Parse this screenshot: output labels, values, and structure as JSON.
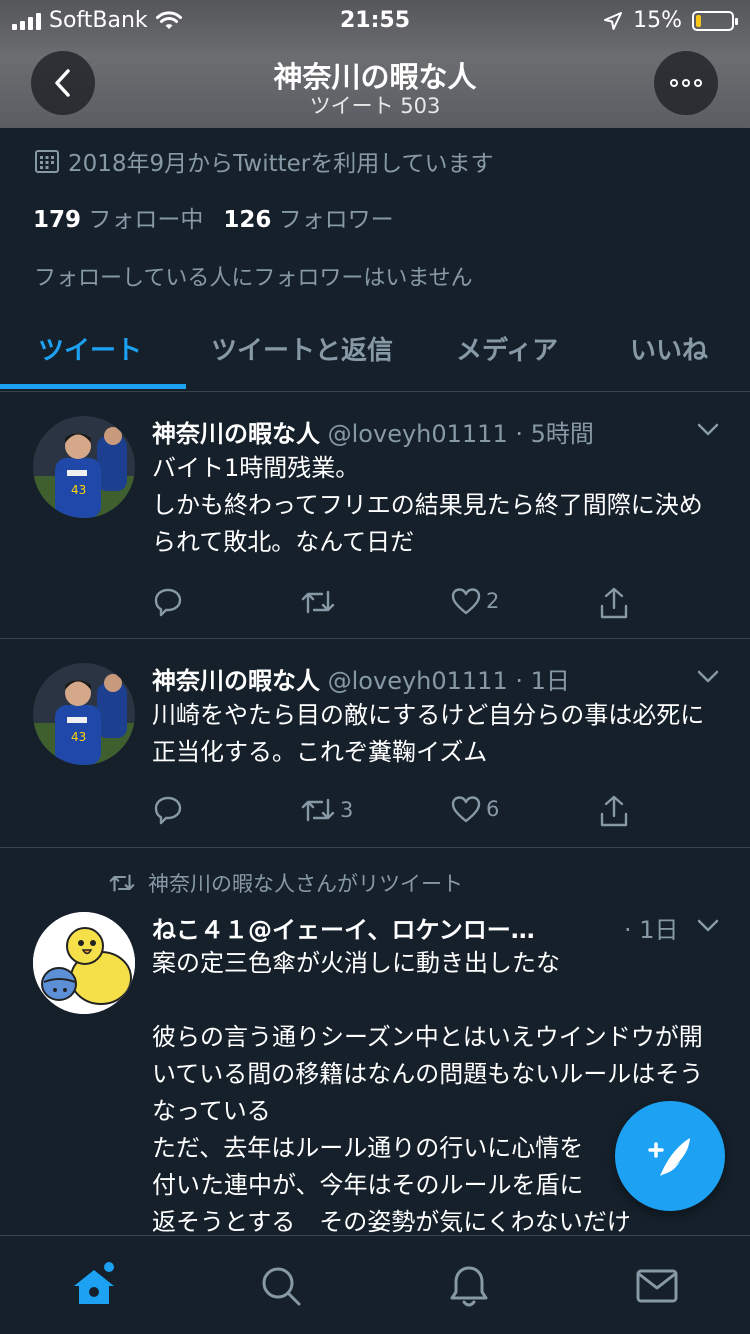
{
  "status_bar": {
    "carrier": "SoftBank",
    "time": "21:55",
    "battery_text": "15%",
    "battery_level": 0.15,
    "icons": [
      "signal-icon",
      "wifi-icon",
      "location-arrow-icon",
      "battery-icon"
    ]
  },
  "header": {
    "title": "神奈川の暇な人",
    "subtitle": "ツイート 503",
    "back_icon": "chevron-left-icon",
    "more_icon": "more-dots-icon"
  },
  "profile": {
    "joined": "2018年9月からTwitterを利用しています",
    "following_count": "179",
    "following_label": "フォロー中",
    "followers_count": "126",
    "followers_label": "フォロワー",
    "no_followers_you_know": "フォローしている人にフォロワーはいません"
  },
  "tabs": [
    {
      "label": "ツイート",
      "active": true
    },
    {
      "label": "ツイートと返信",
      "active": false
    },
    {
      "label": "メディア",
      "active": false
    },
    {
      "label": "いいね",
      "active": false
    }
  ],
  "tweets": [
    {
      "name": "神奈川の暇な人",
      "meta": "@loveyh01111 · 5時間",
      "text": "バイト1時間残業。\nしかも終わってフリエの結果見たら終了間際に決められて敗北。なんて日だ",
      "retweets": "",
      "likes": "2"
    },
    {
      "name": "神奈川の暇な人",
      "meta": "@loveyh01111 · 1日",
      "text": "川崎をやたら目の敵にするけど自分らの事は必死に正当化する。これぞ糞鞠イズム",
      "retweets": "3",
      "likes": "6"
    },
    {
      "retweeted_by": "神奈川の暇な人さんがリツイート",
      "name": "ねこ４１@イェーイ、ロケンロー…",
      "meta": "· 1日",
      "text": "案の定三色傘が火消しに動き出したな\n\n彼らの言う通りシーズン中とはいえウインドウが開いている間の移籍はなんの問題もないルールはそうなっている\nただ、去年はルール通りの行いに心情を\n付いた連中が、今年はそのルールを盾に\n返そうとする　その姿勢が気にくわないだけ"
    }
  ],
  "colors": {
    "background": "#15202b",
    "accent": "#1da1f2",
    "secondary_text": "#8899a6",
    "divider": "#38444d"
  },
  "bottom_nav": [
    "home-icon",
    "search-icon",
    "notifications-bell-icon",
    "messages-envelope-icon"
  ],
  "fab_icon": "compose-tweet-icon"
}
